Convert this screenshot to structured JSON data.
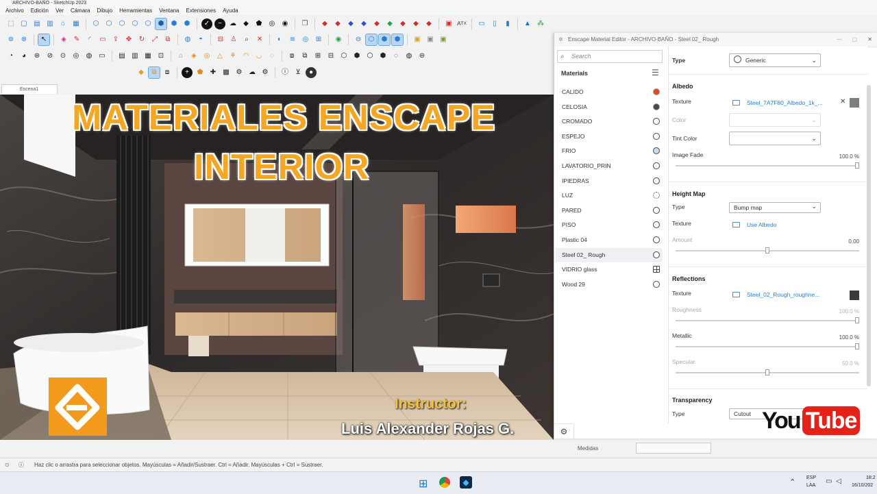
{
  "window": {
    "title": "ARCHIVO-BAÑO - SketchUp 2023"
  },
  "menu": [
    "Archivo",
    "Edición",
    "Ver",
    "Cámara",
    "Dibujo",
    "Herramientas",
    "Ventana",
    "Extensiones",
    "Ayuda"
  ],
  "scene_tab": "Escena1",
  "overlay": {
    "headline_1": "MATERIALES ENSCAPE",
    "headline_2": "INTERIOR",
    "instructor_label": "Instructor:",
    "instructor_name": "Luis Alexander Rojas G.",
    "youtube_you": "You",
    "youtube_tube": "Tube",
    "brand_colors": {
      "enscape": "#f39a1c",
      "youtube_red": "#e62117"
    }
  },
  "enscape": {
    "title": "Enscape Material Editor - ARCHIVO-BAÑO - Steel 02_ Rough",
    "search_placeholder": "Search",
    "materials_header": "Materials",
    "materials": [
      {
        "name": "CALIDO",
        "swatch": "#e8471c",
        "style": "filled"
      },
      {
        "name": "CELOSIA",
        "swatch": "#4a4a48",
        "style": "filled"
      },
      {
        "name": "CROMADO",
        "swatch": "#ffffff",
        "style": "ring"
      },
      {
        "name": "ESPEJO",
        "swatch": "#ffffff",
        "style": "ring"
      },
      {
        "name": "FRIO",
        "swatch": "#c9d9ee",
        "style": "ring"
      },
      {
        "name": "LAVATORIO_PRIN",
        "swatch": "#ffffff",
        "style": "ring"
      },
      {
        "name": "IPIEDRAS",
        "swatch": "#ffffff",
        "style": "ring"
      },
      {
        "name": "LUZ",
        "swatch": "#ffffff",
        "style": "light"
      },
      {
        "name": "PARED",
        "swatch": "#ffffff",
        "style": "ring"
      },
      {
        "name": "PISO",
        "swatch": "#ffffff",
        "style": "ring"
      },
      {
        "name": "Plastic 04",
        "swatch": "#ffffff",
        "style": "ring"
      },
      {
        "name": "Steel 02_ Rough",
        "swatch": "#ffffff",
        "style": "ring",
        "selected": true
      },
      {
        "name": "VIDRIO glass",
        "swatch": "#ffffff",
        "style": "glass"
      },
      {
        "name": "Wood 29",
        "swatch": "#ffffff",
        "style": "ring"
      }
    ],
    "type_label": "Type",
    "type_value": "Generic",
    "albedo": {
      "header": "Albedo",
      "texture_label": "Texture",
      "texture_value": "Steel_7A7F80_Albedo_1k_...",
      "texture_swatch": "#7a7f80",
      "color_label": "Color",
      "tint_label": "Tint Color",
      "fade_label": "Image Fade",
      "fade_value": "100.0 %",
      "fade_fraction": 1.0
    },
    "height": {
      "header": "Height Map",
      "type_label": "Type",
      "type_value": "Bump map",
      "texture_label": "Texture",
      "texture_value": "Use Albedo",
      "amount_label": "Amount",
      "amount_value": "0.00",
      "amount_fraction": 0.5
    },
    "reflections": {
      "header": "Reflections",
      "texture_label": "Texture",
      "texture_value": "Steel_02_Rough_roughne...",
      "texture_swatch": "#3a3a3a",
      "roughness_label": "Roughness",
      "roughness_value": "100.0 %",
      "roughness_fraction": 1.0,
      "metallic_label": "Metallic",
      "metallic_value": "100.0 %",
      "metallic_fraction": 1.0,
      "specular_label": "Specular",
      "specular_value": "50.0 %",
      "specular_fraction": 0.5
    },
    "transparency": {
      "header": "Transparency",
      "type_label": "Type",
      "type_value": "Cutout"
    }
  },
  "status": {
    "hint": "Haz clic o arrastra para seleccionar objetos. Mayúsculas = Añadir/Sustraer. Ctrl = Añadir. Mayúsculas + Ctrl = Sustraer.",
    "medidas_label": "Medidas"
  },
  "taskbar": {
    "lang_1": "ESP",
    "lang_2": "LAA",
    "time": "18:2",
    "date": "16/10/202"
  }
}
